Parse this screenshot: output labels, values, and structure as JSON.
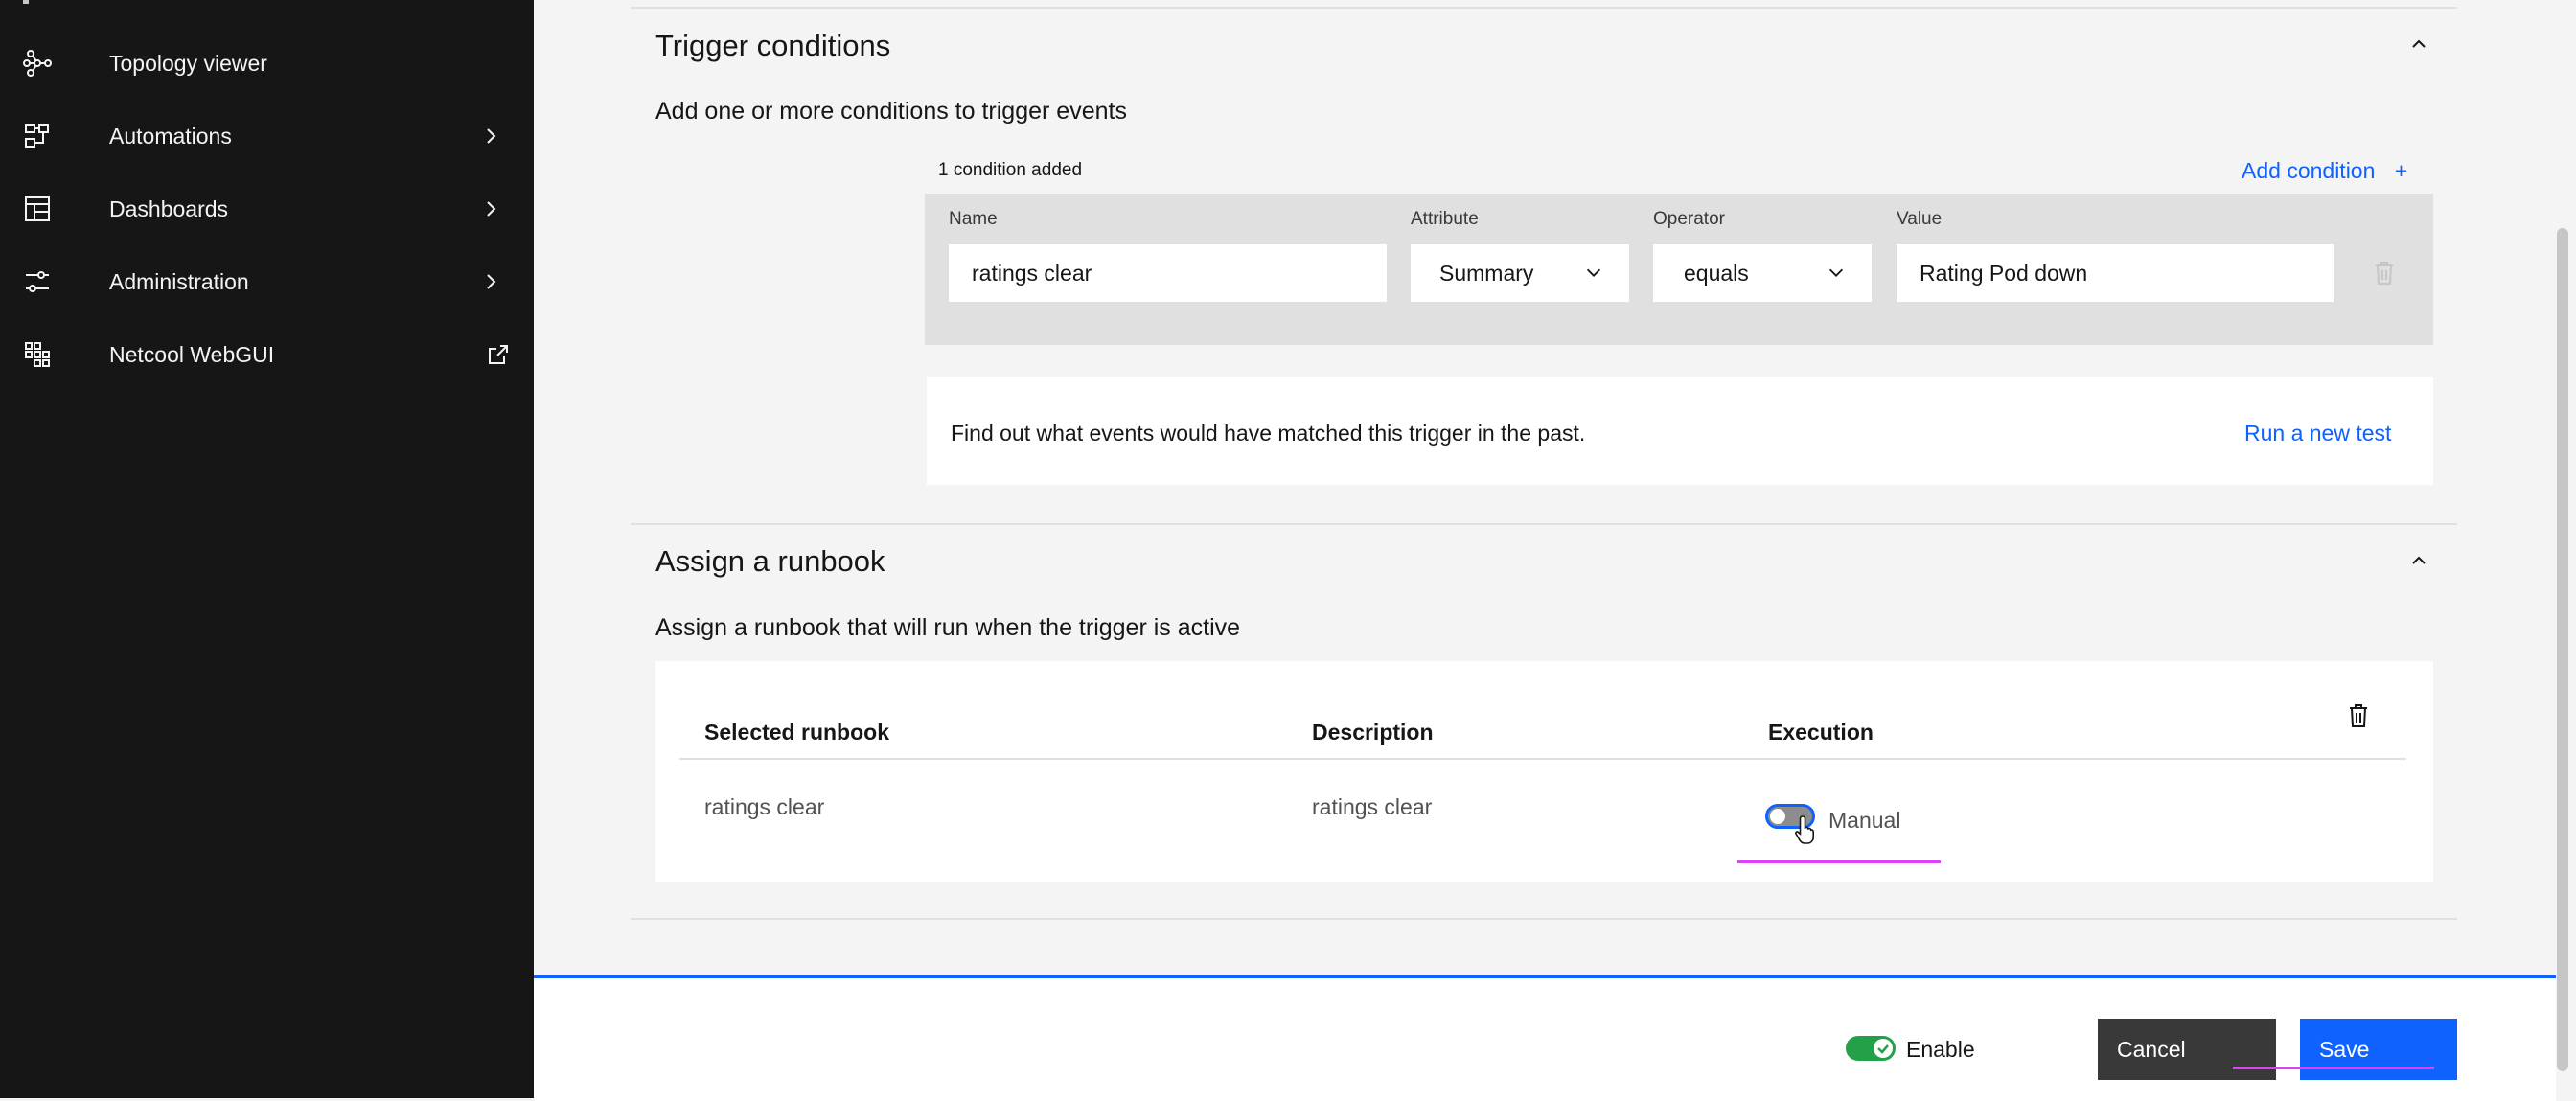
{
  "sidebar": {
    "items": [
      {
        "label": "Topology viewer",
        "icon": "topology-icon"
      },
      {
        "label": "Automations",
        "icon": "automations-icon"
      },
      {
        "label": "Dashboards",
        "icon": "dashboards-icon"
      },
      {
        "label": "Administration",
        "icon": "administration-icon"
      },
      {
        "label": "Netcool WebGUI",
        "icon": "netcool-icon"
      }
    ]
  },
  "trigger": {
    "title": "Trigger conditions",
    "subtitle": "Add one or more conditions to trigger events",
    "count_text": "1 condition added",
    "add_condition": "Add condition",
    "columns": {
      "name": "Name",
      "attribute": "Attribute",
      "operator": "Operator",
      "value": "Value"
    },
    "condition": {
      "name": "ratings clear",
      "attribute": "Summary",
      "operator": "equals",
      "value": "Rating Pod down"
    },
    "test_text": "Find out what events would have matched this trigger in the past.",
    "test_link": "Run a new test"
  },
  "runbook": {
    "title": "Assign a runbook",
    "subtitle": "Assign a runbook that will run when the trigger is active",
    "headers": {
      "selected": "Selected runbook",
      "description": "Description",
      "execution": "Execution"
    },
    "row": {
      "name": "ratings clear",
      "description": "ratings clear",
      "execution": "Manual"
    }
  },
  "footer": {
    "enable_label": "Enable",
    "cancel_label": "Cancel",
    "save_label": "Save"
  },
  "colors": {
    "accent": "#0f62fe",
    "sidebar": "#161616",
    "enable_toggle": "#24a148",
    "annotation": "#e040fb"
  }
}
